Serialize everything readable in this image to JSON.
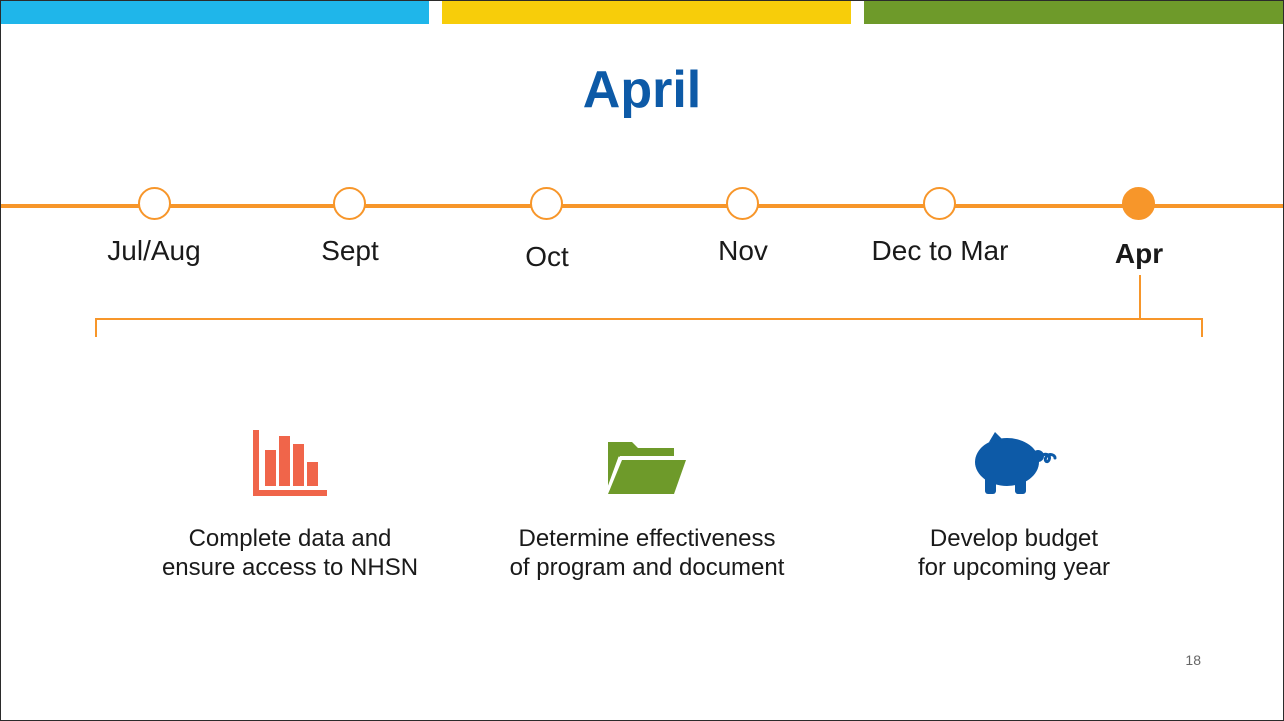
{
  "slide": {
    "title": "April",
    "page_number": "18",
    "colors": {
      "blue_band": "#1fb6ea",
      "yellow_band": "#f7cd0a",
      "green_band": "#6e9a2a",
      "accent_orange": "#f7962a",
      "title_blue": "#0d5aa7"
    }
  },
  "timeline": {
    "months": [
      {
        "label": "Jul/Aug",
        "active": false
      },
      {
        "label": "Sept",
        "active": false
      },
      {
        "label": "Oct",
        "active": false
      },
      {
        "label": "Nov",
        "active": false
      },
      {
        "label": "Dec to Mar",
        "active": false
      },
      {
        "label": "Apr",
        "active": true
      }
    ]
  },
  "tasks": [
    {
      "icon": "bar-chart-icon",
      "line1": "Complete data and",
      "line2": "ensure access to NHSN"
    },
    {
      "icon": "folder-icon",
      "line1": "Determine effectiveness",
      "line2": "of program and document"
    },
    {
      "icon": "piggy-bank-icon",
      "line1": "Develop budget",
      "line2": "for upcoming year"
    }
  ]
}
